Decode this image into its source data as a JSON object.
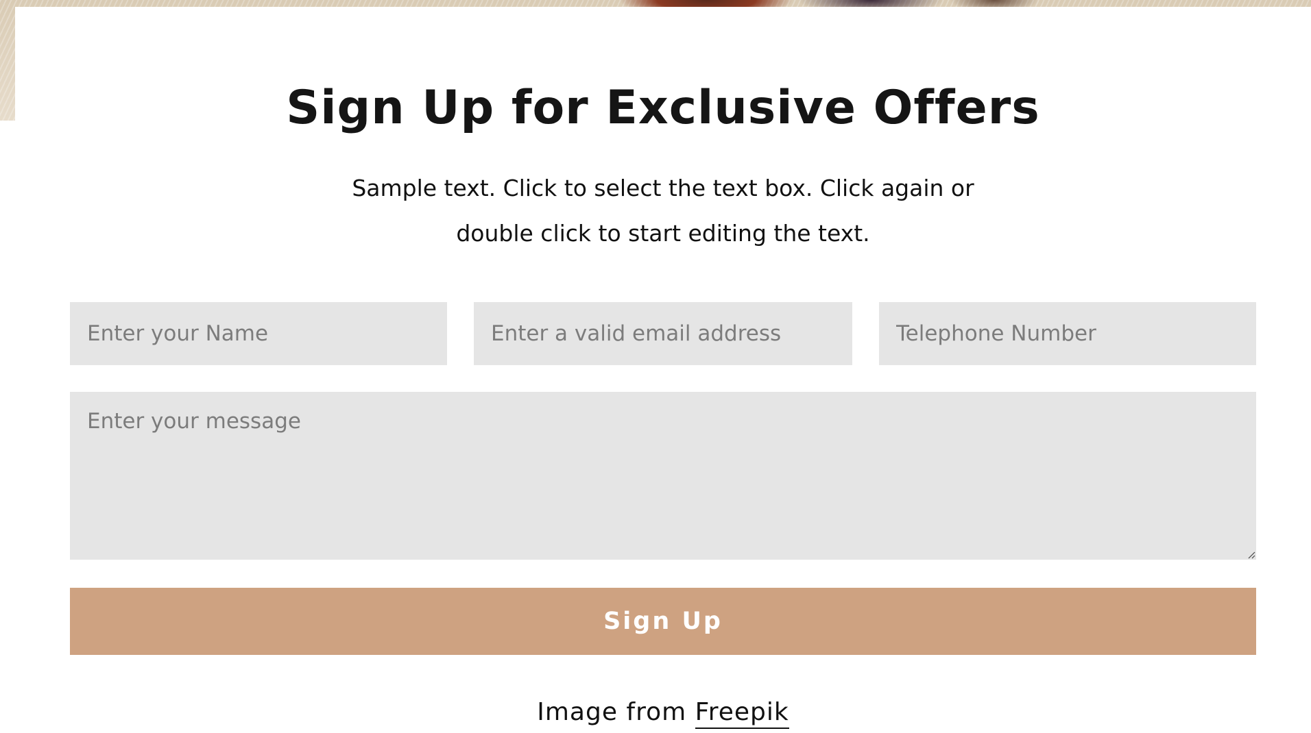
{
  "form": {
    "title": "Sign Up for Exclusive Offers",
    "description_line1": "Sample text. Click to select the text box. Click again or",
    "description_line2": "double click to start editing the text.",
    "fields": {
      "name_placeholder": "Enter your Name",
      "email_placeholder": "Enter a valid email address",
      "phone_placeholder": "Telephone Number",
      "message_placeholder": "Enter your message"
    },
    "submit_label": "Sign Up"
  },
  "credit": {
    "prefix": "Image from",
    "link_text": "Freepik"
  },
  "colors": {
    "button": "#cea281",
    "field_background": "#e5e5e5",
    "title": "#151515"
  }
}
